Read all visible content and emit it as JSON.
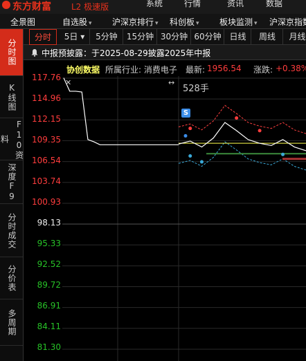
{
  "titlebar": {
    "brand": "东方财富",
    "edition": "L2 极速版",
    "menus": [
      "系统",
      "行情",
      "资讯",
      "数据"
    ]
  },
  "menubar": {
    "items": [
      {
        "label": "全景图",
        "caret": false
      },
      {
        "label": "自选股",
        "caret": true
      },
      {
        "label": "沪深京排行",
        "caret": true
      },
      {
        "label": "科创板",
        "caret": true
      },
      {
        "label": "板块监测",
        "caret": true
      },
      {
        "label": "沪深京指数",
        "caret": false
      }
    ]
  },
  "sidebar": {
    "items": [
      {
        "label": "分时图",
        "active": true
      },
      {
        "label": "K线图",
        "active": false
      },
      {
        "label": "F10资料",
        "active": false
      },
      {
        "label": "深度F9",
        "active": false
      },
      {
        "label": "分时成交",
        "active": false
      },
      {
        "label": "分价表",
        "active": false
      },
      {
        "label": "多周期",
        "active": false
      }
    ]
  },
  "tabs": [
    {
      "label": "分时",
      "active": true
    },
    {
      "label": "5日 ▾",
      "active": false
    },
    {
      "label": "5分钟",
      "active": false
    },
    {
      "label": "15分钟",
      "active": false
    },
    {
      "label": "30分钟",
      "active": false
    },
    {
      "label": "60分钟",
      "active": false
    },
    {
      "label": "日线",
      "active": false
    },
    {
      "label": "周线",
      "active": false
    },
    {
      "label": "月线",
      "active": false
    }
  ],
  "notice": {
    "text": "中报预披露：于2025-08-29披露2025年中报"
  },
  "info": {
    "name": "协创数据",
    "industry": "所属行业: 消费电子",
    "latest_label": "最新:",
    "latest_value": "1956.54",
    "change_label": "涨跌:",
    "change_value": "+0.38%"
  },
  "chart": {
    "volume_label": "528手",
    "badge": "S",
    "colors": {
      "up": "#ff3d3d",
      "down": "#27c227",
      "price": "#ffffff",
      "avg": "#ffff4d",
      "band_up": "#ff4040",
      "band_down": "#3aa9d8"
    }
  },
  "chart_data": {
    "type": "line",
    "y_ticks": [
      "117.76",
      "114.96",
      "112.15",
      "109.35",
      "106.54",
      "103.74",
      "100.93",
      "98.13",
      "95.33",
      "92.52",
      "89.72",
      "86.91",
      "84.11",
      "81.30"
    ],
    "base_price": "98.13",
    "series": [
      {
        "values": [
          117.8,
          116.0,
          116.0,
          115.9,
          109.5,
          109.2,
          108.8,
          108.8,
          108.8,
          108.8,
          108.8,
          108.8,
          108.8,
          108.8,
          108.8,
          108.8,
          108.8,
          108.8,
          108.8,
          108.8
        ]
      },
      {
        "values": [
          108.9,
          109.3,
          108.5,
          109.7,
          111.8,
          110.7,
          109.5,
          109.0,
          108.7,
          109.5,
          108.5,
          108.0
        ]
      }
    ],
    "ylim": [
      81.3,
      117.76
    ]
  }
}
